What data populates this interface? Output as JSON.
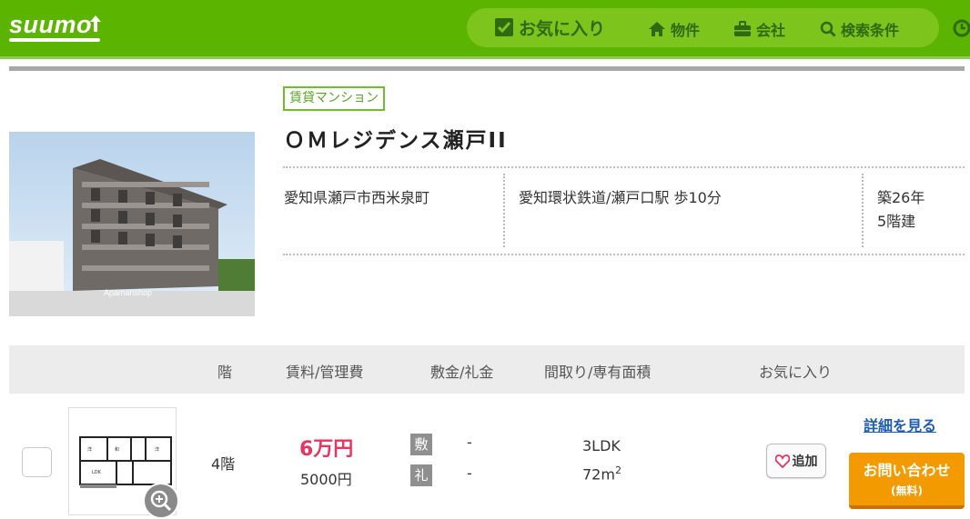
{
  "header": {
    "logo": "suumo",
    "nav": {
      "favorites": "お気に入り",
      "properties": "物件",
      "companies": "会社",
      "search_conditions": "検索条件"
    }
  },
  "property": {
    "type_badge": "賃貸マンション",
    "name": "ＯＭレジデンス瀬戸II",
    "address": "愛知県瀬戸市西米泉町",
    "access": "愛知環状鉄道/瀬戸口駅 歩10分",
    "age": "築26年",
    "floors": "5階建",
    "photo_watermark": "Apamanshop"
  },
  "table": {
    "headers": {
      "floor": "階",
      "rent_fee": "賃料/管理費",
      "deposit_key": "敷金/礼金",
      "layout_area": "間取り/専有面積",
      "favorite": "お気に入り"
    },
    "rows": [
      {
        "floor": "4階",
        "rent": "6万円",
        "management_fee": "5000円",
        "deposit_tag": "敷",
        "deposit": "-",
        "key_money_tag": "礼",
        "key_money": "-",
        "layout": "3LDK",
        "area": "72m",
        "area_sup": "2",
        "add_favorite": "追加",
        "detail_link": "詳細を見る",
        "inquiry": "お問い合わせ",
        "inquiry_note": "(無料)"
      }
    ]
  },
  "colors": {
    "header_green": "#5ab400",
    "nav_pill": "#7dc41d",
    "rent_pink": "#e8345e",
    "inquiry_orange": "#f29a00",
    "link_blue": "#1d5bb5"
  }
}
